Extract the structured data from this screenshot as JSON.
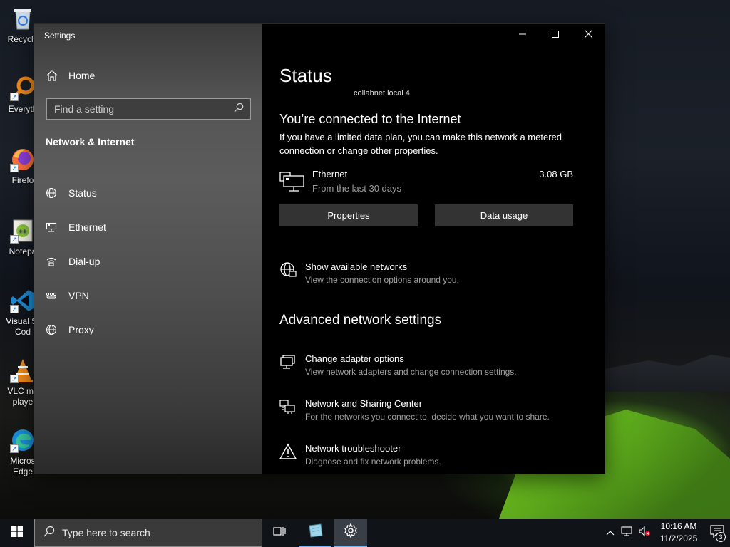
{
  "desktop": {
    "icons": [
      {
        "label": "Recycle",
        "icon": "recycle-bin-icon"
      },
      {
        "label": "Everyth",
        "icon": "everything-search-icon"
      },
      {
        "label": "Firefo",
        "icon": "firefox-icon"
      },
      {
        "label": "Notepa",
        "icon": "notepad-plus-plus-icon"
      },
      {
        "label": "Visual St",
        "label2": "Cod",
        "icon": "vscode-icon"
      },
      {
        "label": "VLC me",
        "label2": "playe",
        "icon": "vlc-icon"
      },
      {
        "label": "Micros",
        "label2": "Edge",
        "icon": "edge-icon"
      }
    ]
  },
  "window": {
    "title": "Settings",
    "controls": {
      "minimize": "minimize-icon",
      "maximize": "maximize-icon",
      "close": "close-icon"
    }
  },
  "nav": {
    "home_label": "Home",
    "search_placeholder": "Find a setting",
    "section_title": "Network & Internet",
    "items": [
      {
        "label": "Status",
        "icon": "globe-icon"
      },
      {
        "label": "Ethernet",
        "icon": "ethernet-icon"
      },
      {
        "label": "Dial-up",
        "icon": "dialup-icon"
      },
      {
        "label": "VPN",
        "icon": "vpn-icon"
      },
      {
        "label": "Proxy",
        "icon": "globe-icon"
      }
    ]
  },
  "content": {
    "page_title": "Status",
    "network_name": "collabnet.local 4",
    "connected_heading": "You’re connected to the Internet",
    "connected_desc": "If you have a limited data plan, you can make this network a metered connection or change other properties.",
    "ethernet": {
      "name": "Ethernet",
      "sub": "From the last 30 days",
      "usage": "3.08 GB"
    },
    "buttons": {
      "properties": "Properties",
      "data_usage": "Data usage"
    },
    "show_networks": {
      "title": "Show available networks",
      "sub": "View the connection options around you."
    },
    "advanced_heading": "Advanced network settings",
    "advanced": [
      {
        "title": "Change adapter options",
        "sub": "View network adapters and change connection settings.",
        "icon": "adapter-icon"
      },
      {
        "title": "Network and Sharing Center",
        "sub": "For the networks you connect to, decide what you want to share.",
        "icon": "sharing-center-icon"
      },
      {
        "title": "Network troubleshooter",
        "sub": "Diagnose and fix network problems.",
        "icon": "warning-icon"
      }
    ]
  },
  "taskbar": {
    "search_placeholder": "Type here to search",
    "time": "10:16 AM",
    "date": "11/2/2025",
    "notification_count": "3"
  }
}
